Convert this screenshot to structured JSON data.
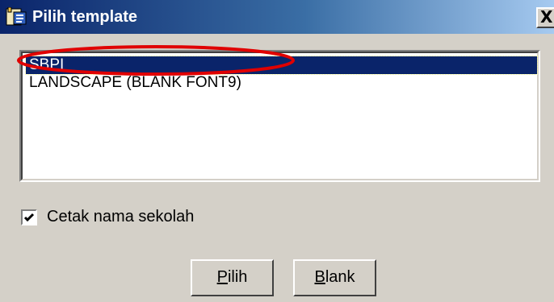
{
  "window": {
    "title": "Pilih template",
    "close_glyph": "X",
    "icon": "template-icon"
  },
  "template_list": {
    "items": [
      {
        "label": "SBPI",
        "selected": true
      },
      {
        "label": "LANDSCAPE (BLANK FONT9)",
        "selected": false
      }
    ],
    "annotation": {
      "shape": "ellipse",
      "color": "#e00000",
      "target": "SBPI"
    }
  },
  "print_school_name": {
    "label": "Cetak nama sekolah",
    "checked": true
  },
  "buttons": {
    "pilih": {
      "accel": "P",
      "rest": "ilih"
    },
    "blank": {
      "accel": "B",
      "rest": "lank"
    }
  },
  "colors": {
    "face": "#d4d0c8",
    "title_start": "#0a246a",
    "title_end": "#a6caf0",
    "selection": "#0a246a",
    "annotation": "#e00000"
  }
}
